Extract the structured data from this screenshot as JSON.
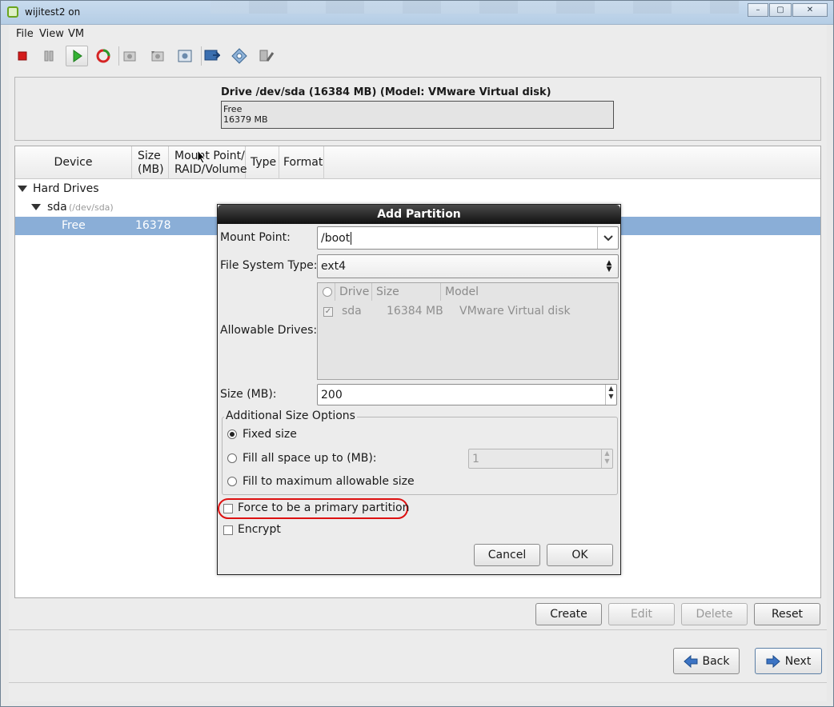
{
  "window": {
    "title": "wijitest2 on",
    "controls": [
      "–",
      "▢",
      "✕"
    ]
  },
  "menu": {
    "file": "File",
    "view": "View",
    "vm": "VM"
  },
  "toolbar": {
    "icons": [
      "stop-icon",
      "pause-icon",
      "play-icon",
      "reset-icon",
      "snapshot-icon",
      "revert-snapshot-icon",
      "manage-snapshots-icon",
      "console-icon",
      "settings-icon",
      "tools-icon"
    ]
  },
  "drive": {
    "title": "Drive /dev/sda (16384 MB) (Model: VMware Virtual disk)",
    "bar_label": "Free",
    "bar_size": "16379 MB"
  },
  "tree": {
    "columns": {
      "device": "Device",
      "size": "Size\n(MB)",
      "mount": "Mount Point/\nRAID/Volume",
      "type": "Type",
      "format": "Format"
    },
    "hard_drives": "Hard Drives",
    "sda_name": "sda",
    "sda_path": "(/dev/sda)",
    "free_label": "Free",
    "free_size": "16378"
  },
  "actions": {
    "create": "Create",
    "edit": "Edit",
    "delete": "Delete",
    "reset": "Reset"
  },
  "nav": {
    "back": "Back",
    "next": "Next"
  },
  "dialog": {
    "title": "Add Partition",
    "mount_label": "Mount Point:",
    "mount_value": "/boot",
    "fs_label": "File System Type:",
    "fs_value": "ext4",
    "drives_label": "Allowable Drives:",
    "drives_columns": {
      "drive": "Drive",
      "size": "Size",
      "model": "Model"
    },
    "drives_row": {
      "drive": "sda",
      "size": "16384 MB",
      "model": "VMware Virtual disk",
      "checked": true
    },
    "size_label": "Size (MB):",
    "size_value": "200",
    "options_title": "Additional Size Options",
    "opt_fixed": "Fixed size",
    "opt_fill_upto": "Fill all space up to (MB):",
    "fill_upto_value": "1",
    "opt_fill_max": "Fill to maximum allowable size",
    "selected_option": "Fixed size",
    "force_primary": "Force to be a primary partition",
    "encrypt": "Encrypt",
    "cancel": "Cancel",
    "ok": "OK"
  },
  "colors": {
    "selection": "#8aaed7",
    "highlight_ring": "#dd1111",
    "dialog_title_bg": "#1f1f1f"
  }
}
